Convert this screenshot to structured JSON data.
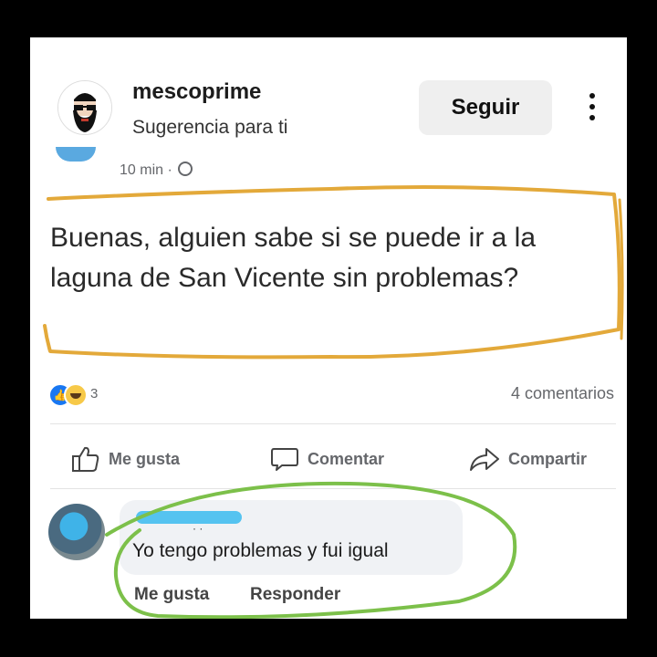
{
  "header": {
    "username": "mescoprime",
    "subtitle": "Sugerencia para ti",
    "follow_label": "Seguir",
    "avatar_icon": "bearded-man-sunglasses-icon",
    "more_icon": "vertical-dots-icon"
  },
  "post": {
    "time": "10 min ·",
    "privacy_icon": "globe-icon",
    "text": "Buenas, alguien sabe si se puede ir a la laguna de San Vicente sin problemas?",
    "reactions": {
      "count": "3",
      "icons": [
        "like-icon",
        "haha-icon"
      ]
    },
    "comments_count": "4 comentarios"
  },
  "actions": {
    "like_label": "Me gusta",
    "comment_label": "Comentar",
    "share_label": "Compartir"
  },
  "comment": {
    "text": "Yo tengo problemas y fui igual",
    "name_obscured": true,
    "like_label": "Me gusta",
    "reply_label": "Responder"
  },
  "colors": {
    "highlight_post": "#e3a93a",
    "highlight_comment": "#7cc04a",
    "background": "#000000",
    "card": "#ffffff",
    "scribble": "#55c3f0"
  }
}
